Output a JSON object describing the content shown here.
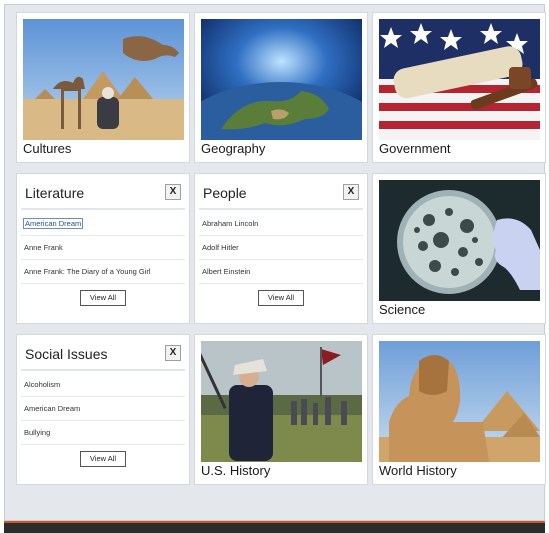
{
  "tiles": {
    "cultures": {
      "label": "Cultures"
    },
    "geography": {
      "label": "Geography"
    },
    "government": {
      "label": "Government"
    },
    "science": {
      "label": "Science"
    },
    "us_history": {
      "label": "U.S. History"
    },
    "world_history": {
      "label": "World History"
    }
  },
  "panels": {
    "literature": {
      "title": "Literature",
      "close": "X",
      "items": [
        "American Dream",
        "Anne Frank",
        "Anne Frank: The Diary of a Young Girl"
      ],
      "view_all": "View All"
    },
    "people": {
      "title": "People",
      "close": "X",
      "items": [
        "Abraham Lincoln",
        "Adolf Hitler",
        "Albert Einstein"
      ],
      "view_all": "View All"
    },
    "social_issues": {
      "title": "Social Issues",
      "close": "X",
      "items": [
        "Alcoholism",
        "American Dream",
        "Bullying"
      ],
      "view_all": "View All"
    }
  },
  "icons": [
    "close-icon"
  ],
  "colors": {
    "frame_bg": "#e4e8ed",
    "selection": "#6f8fb8",
    "footer": "#2c2c2c",
    "footer_accent": "#c85a2a"
  }
}
